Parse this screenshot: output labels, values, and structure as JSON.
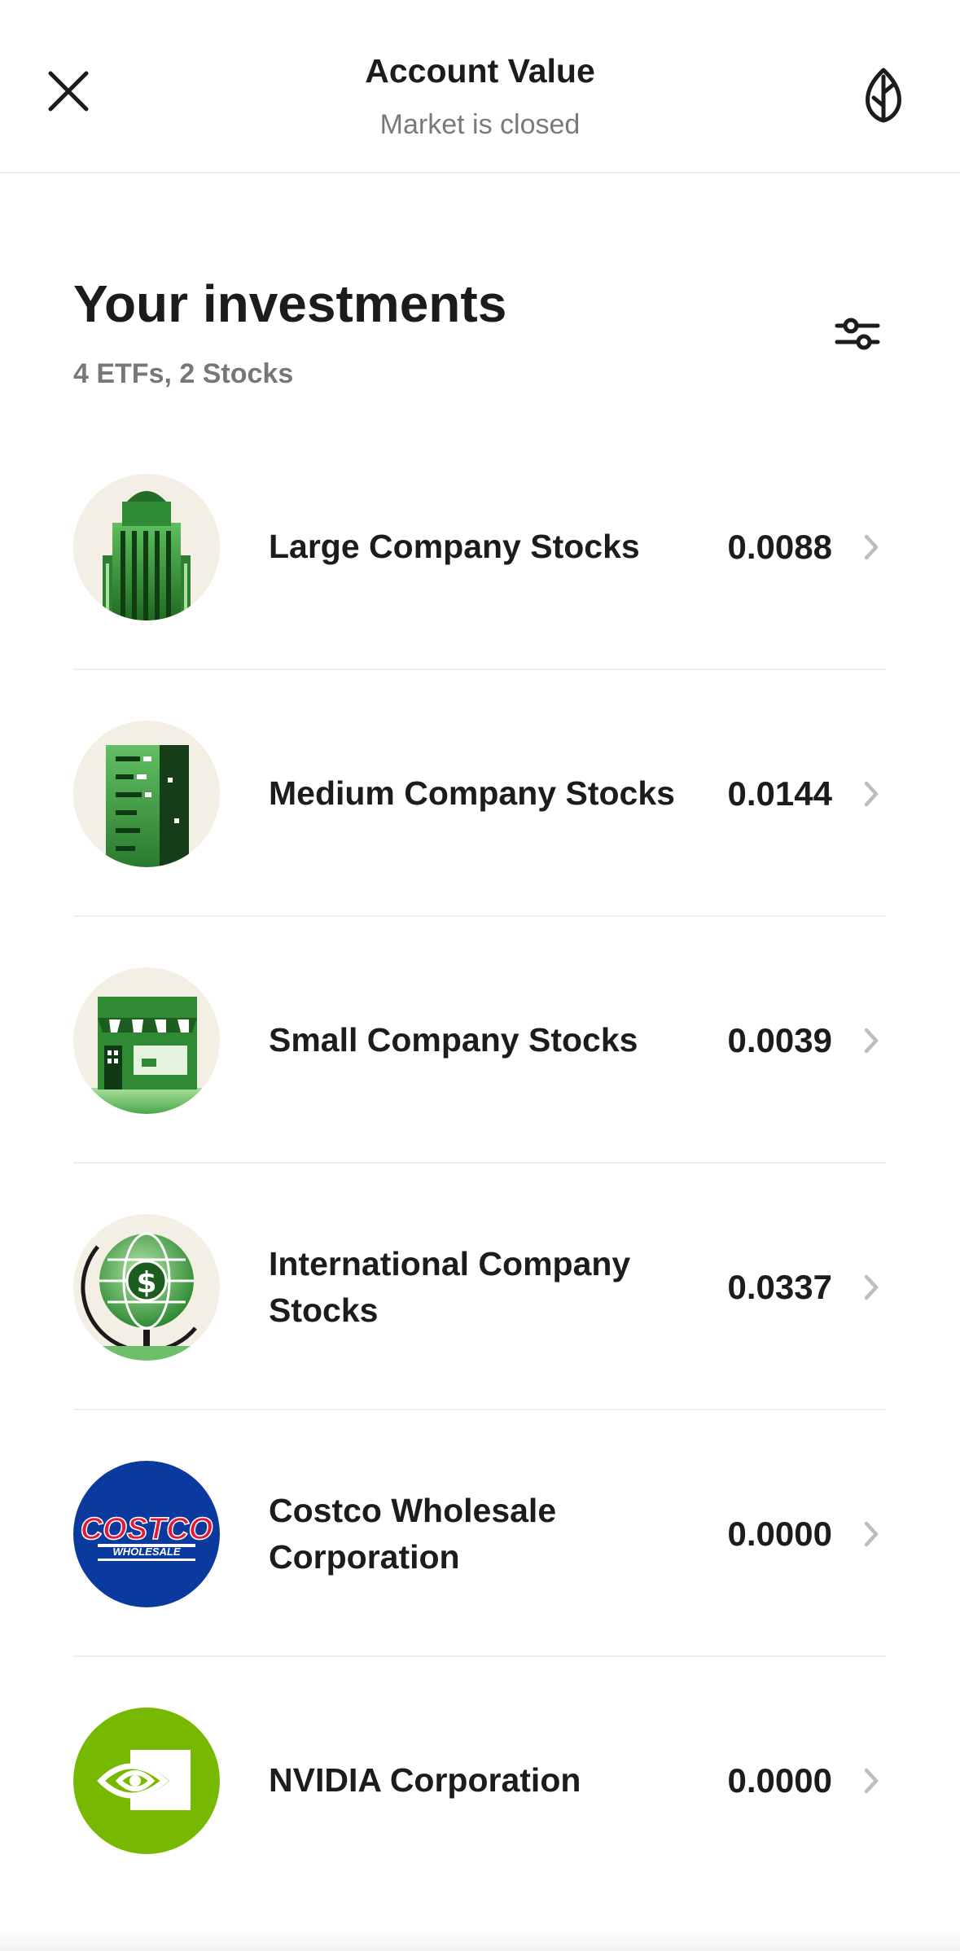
{
  "header": {
    "title": "Account Value",
    "subtitle": "Market is closed",
    "close_icon": "close-icon",
    "leaf_icon": "leaf-icon"
  },
  "investments": {
    "title": "Your investments",
    "subtitle": "4 ETFs, 2 Stocks",
    "filter_icon": "sliders-icon",
    "items": [
      {
        "name": "Large Company Stocks",
        "value": "0.0088",
        "icon": "skyscraper-icon"
      },
      {
        "name": "Medium Company Stocks",
        "value": "0.0144",
        "icon": "office-building-icon"
      },
      {
        "name": "Small Company Stocks",
        "value": "0.0039",
        "icon": "storefront-icon"
      },
      {
        "name": "International Company Stocks",
        "value": "0.0337",
        "icon": "globe-dollar-icon"
      },
      {
        "name": "Costco Wholesale Corporation",
        "value": "0.0000",
        "icon": "costco-logo"
      },
      {
        "name": "NVIDIA Corporation",
        "value": "0.0000",
        "icon": "nvidia-logo"
      }
    ]
  },
  "logos": {
    "costco": {
      "top": "COSTCO",
      "bottom": "WHOLESALE"
    }
  },
  "colors": {
    "green_dark": "#1f5a1f",
    "green": "#3f9a3f",
    "green_light": "#8fd08a",
    "costco_blue": "#0a3a9e",
    "costco_red": "#e31837",
    "nvidia_green": "#76b900"
  }
}
